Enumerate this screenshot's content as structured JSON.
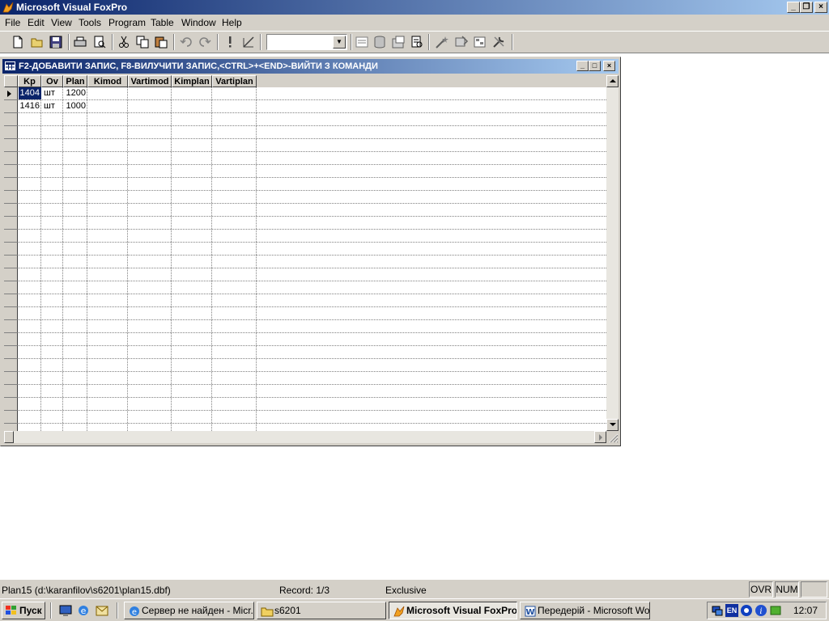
{
  "app": {
    "title": "Microsoft Visual FoxPro"
  },
  "menu": [
    "File",
    "Edit",
    "View",
    "Tools",
    "Program",
    "Table",
    "Window",
    "Help"
  ],
  "browse": {
    "title": "F2-ДОБАВИТИ ЗАПИС, F8-ВИЛУЧИТИ ЗАПИС,<CTRL>+<END>-ВИЙТИ З КОМАНДИ",
    "columns": [
      "Kp",
      "Ov",
      "Plan",
      "Kimod",
      "Vartimod",
      "Kimplan",
      "Vartiplan"
    ],
    "rows": [
      [
        "1404",
        "шт",
        "1200",
        "",
        "",
        "",
        ""
      ],
      [
        "1416",
        "шт",
        "1000",
        "",
        "",
        "",
        ""
      ]
    ]
  },
  "status": {
    "file": "Plan15 (d:\\karanfilov\\s6201\\plan15.dbf)",
    "record": "Record: 1/3",
    "mode": "Exclusive",
    "ovr": "OVR",
    "num": "NUM"
  },
  "taskbar": {
    "start": "Пуск",
    "tasks": [
      {
        "label": "Сервер не найден - Micr...",
        "icon": "ie-icon",
        "active": false
      },
      {
        "label": "s6201",
        "icon": "folder-icon",
        "active": false
      },
      {
        "label": "Microsoft Visual FoxPro",
        "icon": "foxpro-icon",
        "active": true
      },
      {
        "label": "Передерій - Microsoft Word",
        "icon": "word-icon",
        "active": false
      }
    ],
    "tray": {
      "lang": "EN",
      "clock": "12:07"
    }
  }
}
